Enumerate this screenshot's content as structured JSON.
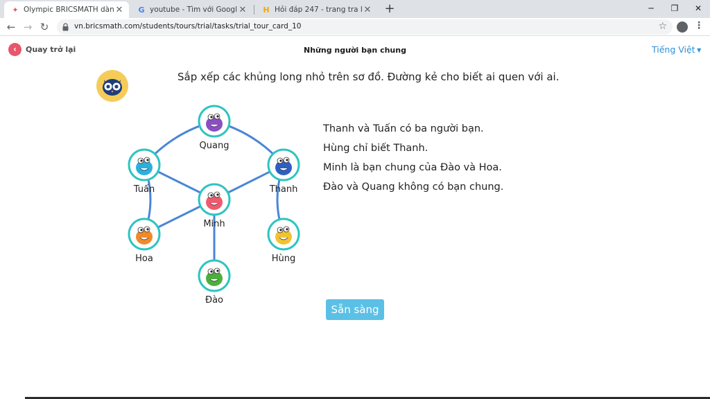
{
  "browser": {
    "tabs": [
      {
        "title": "Olympic BRICSMATH dành cho h",
        "active": true
      },
      {
        "title": "youtube - Tìm với Google",
        "active": false
      },
      {
        "title": "Hỏi đáp 247 - trang tra loi",
        "active": false
      }
    ],
    "url": "vn.bricsmath.com/students/tours/trial/tasks/trial_tour_card_10"
  },
  "header": {
    "back_label": "Quay trở lại",
    "title": "Những người bạn chung",
    "language": "Tiếng Việt"
  },
  "instruction": "Sắp xếp các khủng long nhỏ trên sơ đồ. Đường kẻ cho biết ai quen với ai.",
  "graph": {
    "nodes": [
      {
        "name": "Quang",
        "color": "#8a4fc2"
      },
      {
        "name": "Tuấn",
        "color": "#2ab0e0"
      },
      {
        "name": "Thanh",
        "color": "#2f5fc0"
      },
      {
        "name": "Minh",
        "color": "#ef5a6e"
      },
      {
        "name": "Hoa",
        "color": "#f08a2a"
      },
      {
        "name": "Hùng",
        "color": "#f2c230"
      },
      {
        "name": "Đào",
        "color": "#4caf3d"
      }
    ],
    "edges": [
      [
        "Quang",
        "Tuấn"
      ],
      [
        "Quang",
        "Thanh"
      ],
      [
        "Tuấn",
        "Minh"
      ],
      [
        "Thanh",
        "Minh"
      ],
      [
        "Tuấn",
        "Hoa"
      ],
      [
        "Minh",
        "Hoa"
      ],
      [
        "Thanh",
        "Hùng"
      ],
      [
        "Minh",
        "Đào"
      ]
    ],
    "edge_color": "#4a86d6",
    "ring_color": "#2ec4c2"
  },
  "clues": [
    "Thanh và Tuấn có ba người bạn.",
    "Hùng chỉ biết Thanh.",
    "Minh là bạn chung của Đào và Hoa.",
    "Đào và Quang không có bạn chung."
  ],
  "ready_label": "Sẵn sàng"
}
